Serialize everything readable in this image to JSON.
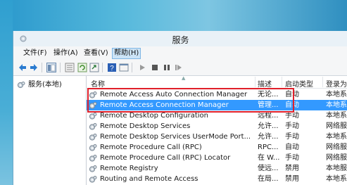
{
  "window": {
    "title": "服务"
  },
  "menu": {
    "file": "文件(F)",
    "action": "操作(A)",
    "view": "查看(V)",
    "help": "帮助(H)"
  },
  "toolbar": {
    "icons": [
      "back-arrow-icon",
      "forward-arrow-icon",
      "console-tree-icon",
      "properties-icon",
      "refresh-icon",
      "export-list-icon",
      "help-icon",
      "show-pane-icon",
      "play-icon",
      "stop-icon",
      "pause-icon",
      "restart-icon"
    ]
  },
  "tree": {
    "root_label": "服务(本地)"
  },
  "columns": {
    "name": "名称",
    "description": "描述",
    "startup_type": "启动类型",
    "log_on_as": "登录为"
  },
  "services": [
    {
      "name": "Remote Access Auto Connection Manager",
      "description": "无论...",
      "startup": "自动",
      "logon": "本地系统",
      "selected": false
    },
    {
      "name": "Remote Access Connection Manager",
      "description": "管理...",
      "startup": "自动",
      "logon": "本地系统",
      "selected": true
    },
    {
      "name": "Remote Desktop Configuration",
      "description": "远程...",
      "startup": "手动",
      "logon": "本地系统",
      "selected": false
    },
    {
      "name": "Remote Desktop Services",
      "description": "允许...",
      "startup": "手动",
      "logon": "网络服务",
      "selected": false
    },
    {
      "name": "Remote Desktop Services UserMode Port...",
      "description": "允许...",
      "startup": "手动",
      "logon": "本地系统",
      "selected": false
    },
    {
      "name": "Remote Procedure Call (RPC)",
      "description": "RPC...",
      "startup": "自动",
      "logon": "网络服务",
      "selected": false
    },
    {
      "name": "Remote Procedure Call (RPC) Locator",
      "description": "在 W...",
      "startup": "手动",
      "logon": "网络服务",
      "selected": false
    },
    {
      "name": "Remote Registry",
      "description": "使远...",
      "startup": "禁用",
      "logon": "本地服务",
      "selected": false
    },
    {
      "name": "Routing and Remote Access",
      "description": "在局...",
      "startup": "禁用",
      "logon": "本地系统",
      "selected": false
    }
  ],
  "colors": {
    "selection": "#3399ff",
    "highlight_box": "#e0202a",
    "desktop": "#3ea6cf"
  }
}
